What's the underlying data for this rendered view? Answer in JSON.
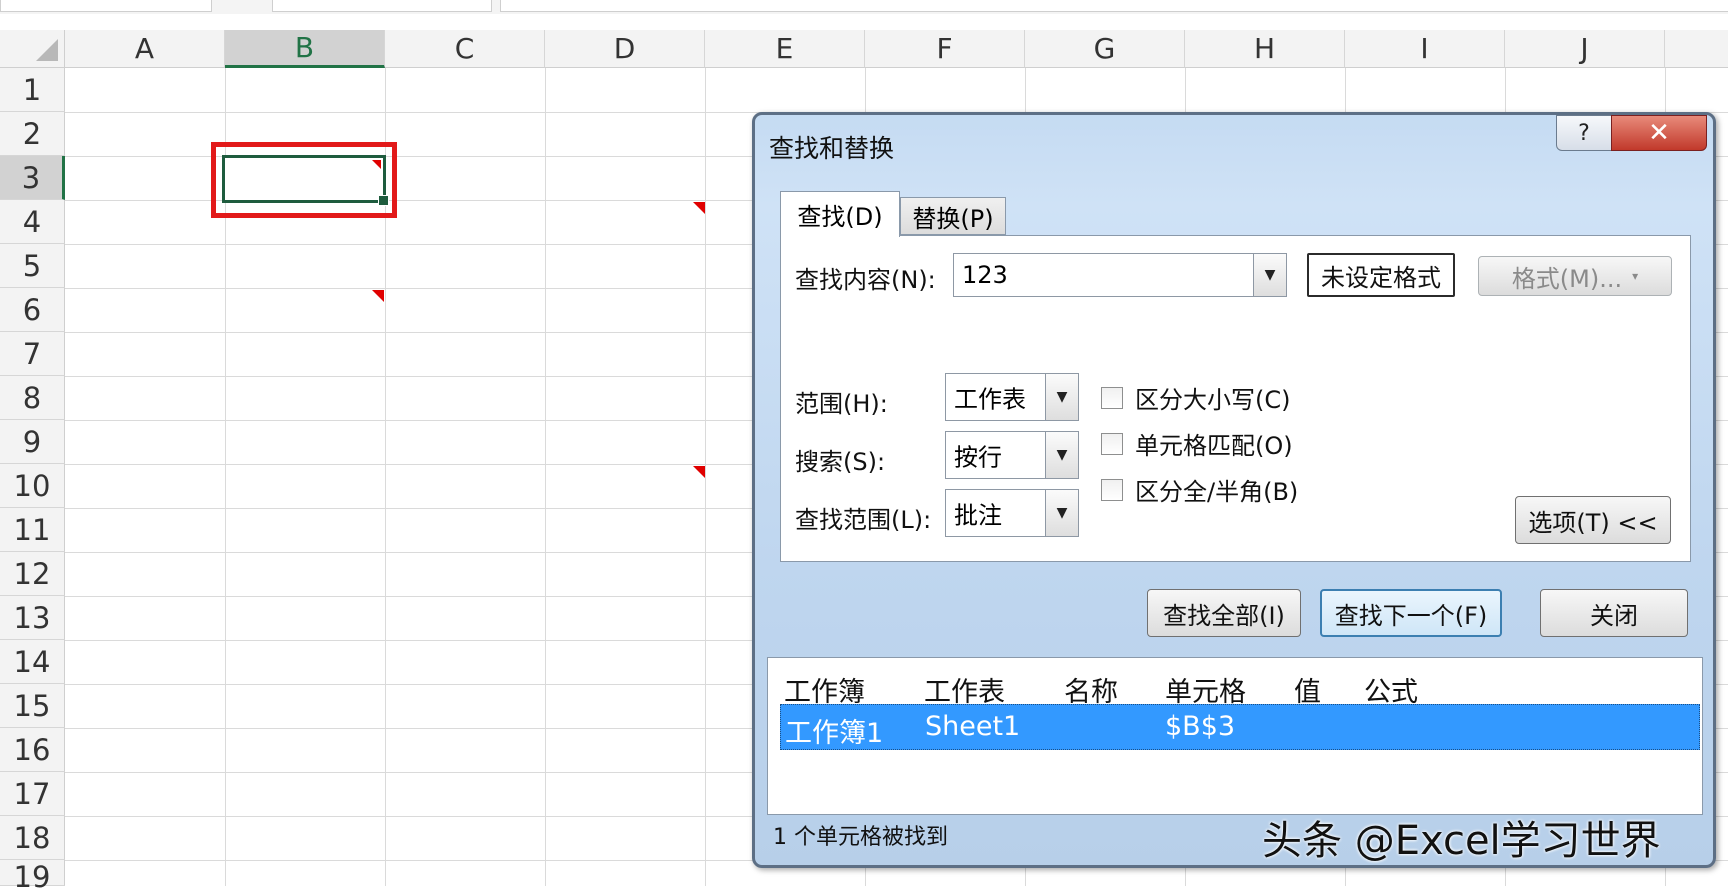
{
  "sheet": {
    "columns": [
      "A",
      "B",
      "C",
      "D",
      "E",
      "F",
      "G",
      "H",
      "I",
      "J"
    ],
    "selected_column": "B",
    "rows": [
      "1",
      "2",
      "3",
      "4",
      "5",
      "6",
      "7",
      "8",
      "9",
      "10",
      "11",
      "12",
      "13",
      "14",
      "15",
      "16",
      "17",
      "18",
      "19"
    ],
    "selected_row": "3"
  },
  "dialog": {
    "title": "查找和替换",
    "help_glyph": "?",
    "close_glyph": "✕",
    "tabs": [
      {
        "label": "查找(D)",
        "active": true
      },
      {
        "label": "替换(P)",
        "active": false
      }
    ],
    "find_label": "查找内容(N):",
    "find_value": "123",
    "format_status": "未设定格式",
    "format_button": "格式(M)...",
    "scope_label": "范围(H):",
    "scope_value": "工作表",
    "search_label": "搜索(S):",
    "search_value": "按行",
    "lookin_label": "查找范围(L):",
    "lookin_value": "批注",
    "options": [
      {
        "label": "区分大小写(C)",
        "checked": false
      },
      {
        "label": "单元格匹配(O)",
        "checked": false
      },
      {
        "label": "区分全/半角(B)",
        "checked": false
      }
    ],
    "options_button": "选项(T) <<",
    "find_all_button": "查找全部(I)",
    "find_next_button": "查找下一个(F)",
    "close_button": "关闭",
    "results": {
      "headers": [
        "工作簿",
        "工作表",
        "名称",
        "单元格",
        "值",
        "公式"
      ],
      "rows": [
        {
          "workbook": "工作簿1",
          "sheet": "Sheet1",
          "name": "",
          "cell": "$B$3",
          "value": "",
          "formula": ""
        }
      ]
    },
    "status": "1 个单元格被找到"
  },
  "watermark": "头条 @Excel学习世界",
  "colors": {
    "selection": "#3399ff",
    "highlight": "#e21a1a",
    "accent": "#217346"
  }
}
